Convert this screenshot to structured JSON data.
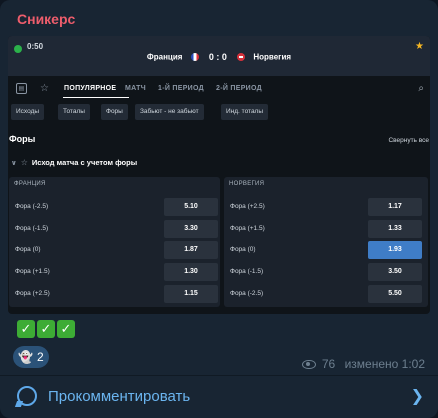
{
  "post": {
    "sender_name": "Сникерс",
    "checkmarks": [
      "✓",
      "✓",
      "✓"
    ],
    "reaction": {
      "emoji": "👻",
      "count": "2"
    },
    "views": "76",
    "edited_label": "изменено",
    "time": "1:02",
    "comment_label": "Прокомментировать"
  },
  "screenshot": {
    "match": {
      "time": "0:50",
      "home_team": "Франция",
      "away_team": "Норвегия",
      "score": "0 : 0"
    },
    "tabs": [
      {
        "label": "ПОПУЛЯРНОЕ",
        "active": true
      },
      {
        "label": "МАТЧ",
        "active": false
      },
      {
        "label": "1-Й ПЕРИОД",
        "active": false
      },
      {
        "label": "2-Й ПЕРИОД",
        "active": false
      }
    ],
    "chips": [
      "Исходы",
      "Тоталы",
      "Форы",
      "Забьют - не забьют",
      "Инд. тоталы"
    ],
    "section_title": "Форы",
    "collapse_all": "Свернуть все",
    "market_title": "Исход матча с учетом форы",
    "left_column": {
      "header": "ФРАНЦИЯ",
      "rows": [
        {
          "label": "Фора (-2.5)",
          "odd": "5.10"
        },
        {
          "label": "Фора (-1.5)",
          "odd": "3.30"
        },
        {
          "label": "Фора (0)",
          "odd": "1.87"
        },
        {
          "label": "Фора (+1.5)",
          "odd": "1.30"
        },
        {
          "label": "Фора (+2.5)",
          "odd": "1.15"
        }
      ]
    },
    "right_column": {
      "header": "НОРВЕГИЯ",
      "rows": [
        {
          "label": "Фора (+2.5)",
          "odd": "1.17"
        },
        {
          "label": "Фора (+1.5)",
          "odd": "1.33"
        },
        {
          "label": "Фора (0)",
          "odd": "1.93",
          "selected": true
        },
        {
          "label": "Фора (-1.5)",
          "odd": "3.50"
        },
        {
          "label": "Фора (-2.5)",
          "odd": "5.50"
        }
      ]
    }
  },
  "colors": {
    "sender": "#ee5d6c",
    "selected_odd": "#3f7dc7",
    "link": "#6bb5f0",
    "checkmark_bg": "#3dac35"
  }
}
